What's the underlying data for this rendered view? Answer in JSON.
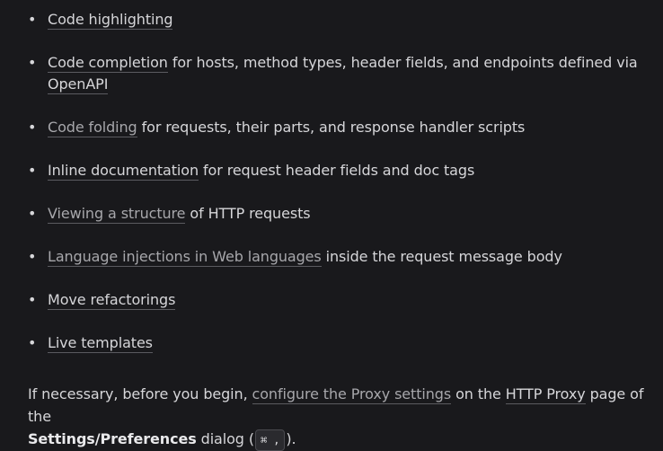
{
  "features": [
    {
      "link": "Code highlighting",
      "text": ""
    },
    {
      "link": "Code completion",
      "text": " for hosts, method types, header fields, and endpoints defined via"
    },
    {
      "link": "Code folding",
      "text": " for requests, their parts, and response handler scripts"
    },
    {
      "link": "Inline documentation",
      "text": " for request header fields and doc tags"
    },
    {
      "link": "Viewing a structure",
      "text": " of HTTP requests"
    },
    {
      "link": "Language injections in Web languages",
      "text": " inside the request message body"
    },
    {
      "link": "Move refactorings",
      "text": ""
    },
    {
      "link": "Live templates",
      "text": ""
    }
  ],
  "openapi_link": "OpenAPI",
  "bullet_glyph": "•",
  "para": {
    "intro": "If necessary, before you begin, ",
    "proxy_link": "configure the Proxy settings",
    "mid": " on the ",
    "http_proxy_link": "HTTP Proxy",
    "after": " page of the",
    "settings_bold": "Settings/Preferences",
    "dialog": " dialog (",
    "shortcut": "⌘ ,",
    "close": ")."
  },
  "colors": {
    "background": "#19191c",
    "text": "#d6d6d9",
    "muted_link": "#a7a7ab"
  }
}
